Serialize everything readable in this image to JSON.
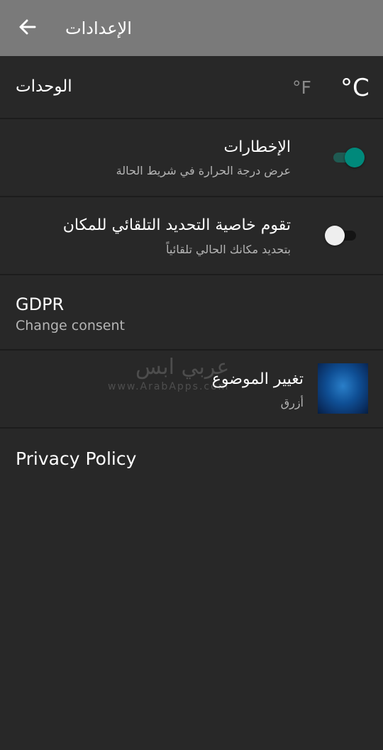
{
  "header": {
    "title": "الإعدادات",
    "back_icon": "arrow-back-icon"
  },
  "units": {
    "label": "الوحدات",
    "fahrenheit": "°F",
    "celsius": "°C",
    "selected": "celsius"
  },
  "notifications": {
    "title": "الإخطارات",
    "subtitle": "عرض درجة الحرارة في شريط الحالة",
    "enabled": true
  },
  "auto_location": {
    "title": "تقوم خاصية التحديد التلقائي للمكان",
    "subtitle": "بتحديد مكانك الحالي تلقائياً",
    "enabled": false
  },
  "gdpr": {
    "title": "GDPR",
    "subtitle": "Change consent"
  },
  "theme": {
    "title": "تغيير الموضوع",
    "subtitle": "أزرق"
  },
  "watermark": {
    "text": "عربي ابس",
    "url": "www.ArabApps.com"
  },
  "privacy": {
    "label": "Privacy Policy"
  },
  "colors": {
    "background": "#282828",
    "header": "#7a7a7a",
    "accent": "#00897b",
    "accent_track": "#1f5a52",
    "off_thumb": "#eeeeee",
    "off_track": "#141414"
  }
}
